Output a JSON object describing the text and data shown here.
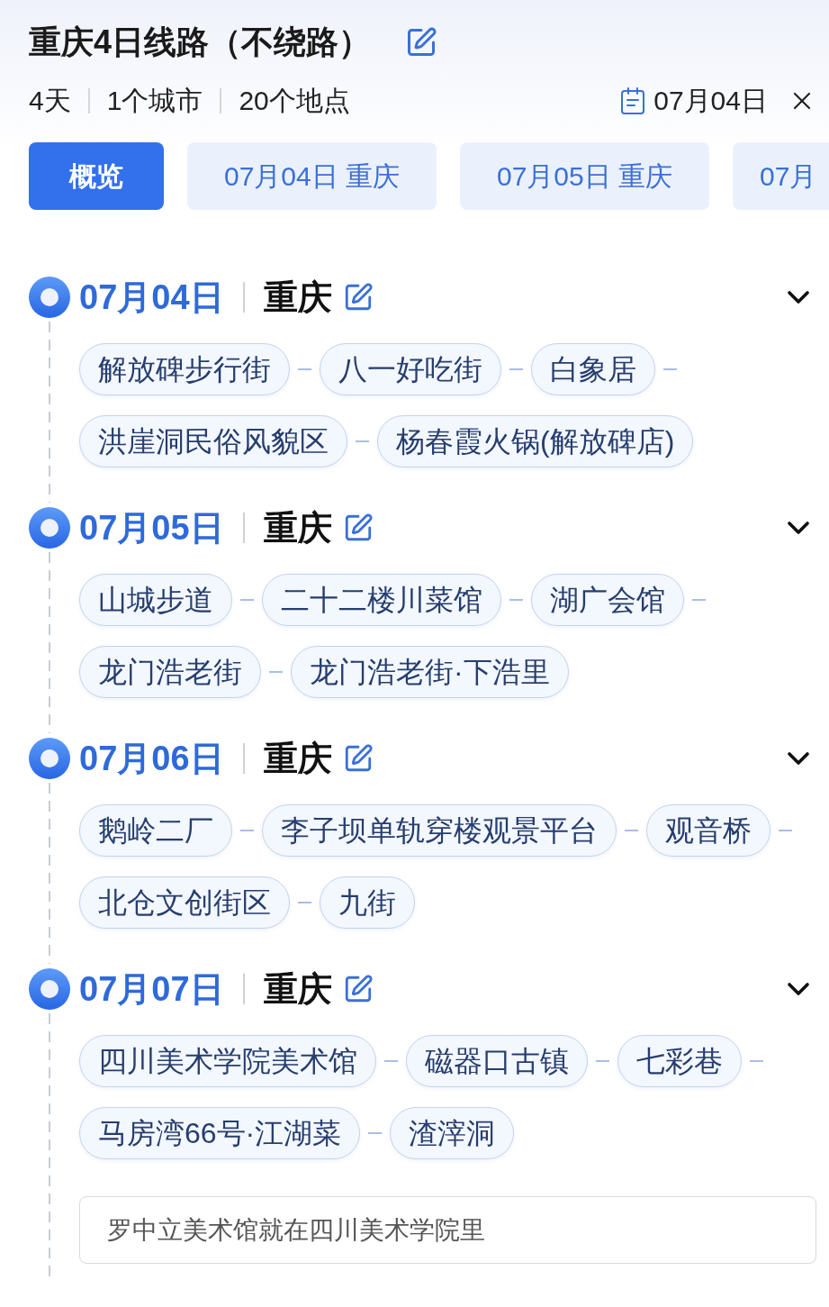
{
  "header": {
    "title": "重庆4日线路（不绕路）",
    "stats": [
      "4天",
      "1个城市",
      "20个地点"
    ],
    "date": "07月04日"
  },
  "tabs": [
    {
      "label": "概览",
      "selected": true
    },
    {
      "label": "07月04日 重庆",
      "selected": false
    },
    {
      "label": "07月05日 重庆",
      "selected": false
    },
    {
      "label": "07月",
      "selected": false
    }
  ],
  "days": [
    {
      "date": "07月04日",
      "city": "重庆",
      "places": [
        "解放碑步行街",
        "八一好吃街",
        "白象居",
        "洪崖洞民俗风貌区",
        "杨春霞火锅(解放碑店)"
      ]
    },
    {
      "date": "07月05日",
      "city": "重庆",
      "places": [
        "山城步道",
        "二十二楼川菜馆",
        "湖广会馆",
        "龙门浩老街",
        "龙门浩老街·下浩里"
      ]
    },
    {
      "date": "07月06日",
      "city": "重庆",
      "places": [
        "鹅岭二厂",
        "李子坝单轨穿楼观景平台",
        "观音桥",
        "北仓文创街区",
        "九街"
      ]
    },
    {
      "date": "07月07日",
      "city": "重庆",
      "places": [
        "四川美术学院美术馆",
        "磁器口古镇",
        "七彩巷",
        "马房湾66号·江湖菜",
        "渣滓洞"
      ],
      "note": "罗中立美术馆就在四川美术学院里"
    }
  ]
}
